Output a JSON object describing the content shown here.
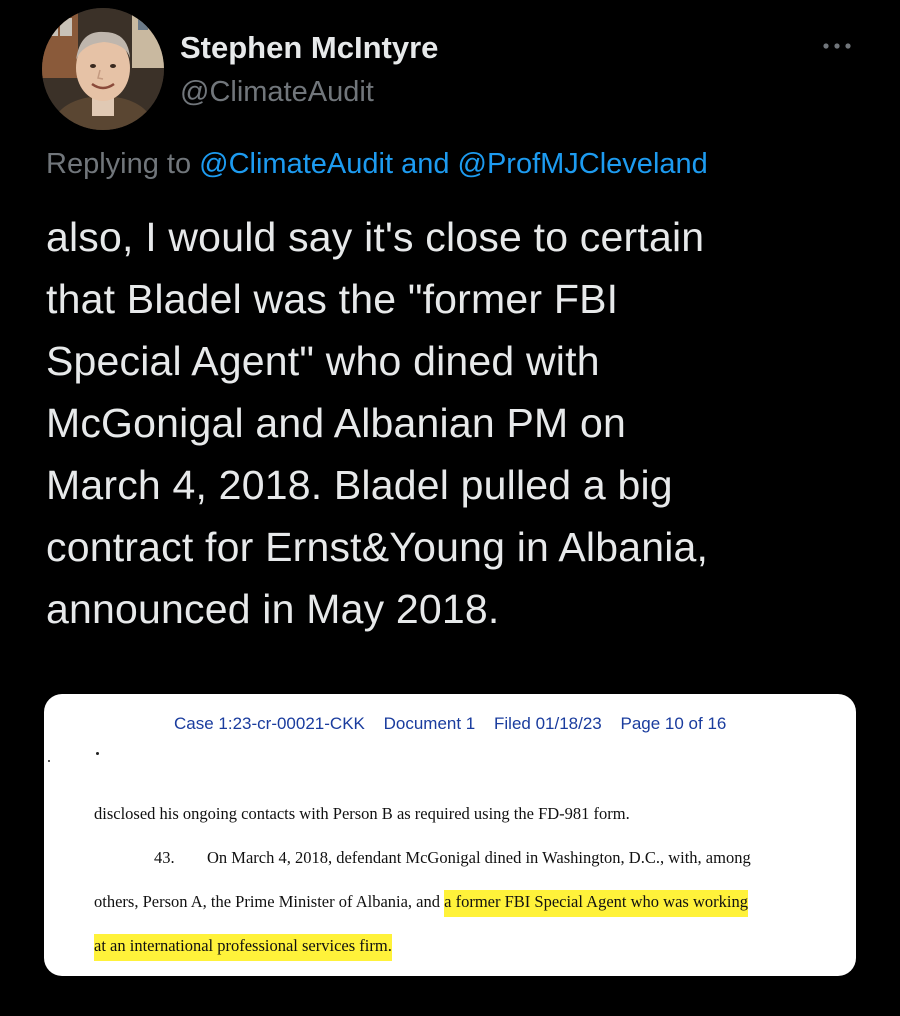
{
  "author": {
    "display_name": "Stephen McIntyre",
    "handle": "@ClimateAudit"
  },
  "reply_context": {
    "prefix": "Replying to",
    "mention_1": "@ClimateAudit",
    "joiner": "and",
    "mention_2": "@ProfMJCleveland"
  },
  "tweet": {
    "lines": [
      "also, I would say it's close to certain",
      "that Bladel was the \"former FBI",
      "Special Agent\" who dined with",
      "McGonigal and Albanian PM on",
      "March 4, 2018. Bladel pulled a big",
      "contract for Ernst&Young in Albania,",
      "announced in May 2018."
    ]
  },
  "document": {
    "header": {
      "case": "Case 1:23-cr-00021-CKK",
      "doc": "Document 1",
      "filed": "Filed 01/18/23",
      "page": "Page 10 of 16"
    },
    "line_1": "disclosed his ongoing contacts with Person B as required using the FD-981 form.",
    "para_number": "43.",
    "line_2": "On March 4, 2018, defendant McGonigal dined in Washington, D.C., with, among",
    "line_3_plain": "others, Person A, the Prime Minister of Albania, and ",
    "line_3_highlight": "a former FBI Special Agent who was working",
    "line_4_highlight": "at an international professional services firm."
  },
  "colors": {
    "background": "#000000",
    "text_primary": "#e7e9ea",
    "text_secondary": "#71767b",
    "link": "#1d9bf0",
    "highlight": "#fff23a",
    "doc_header": "#1a3c9e"
  },
  "icons": {
    "more": "more-horizontal-icon"
  }
}
